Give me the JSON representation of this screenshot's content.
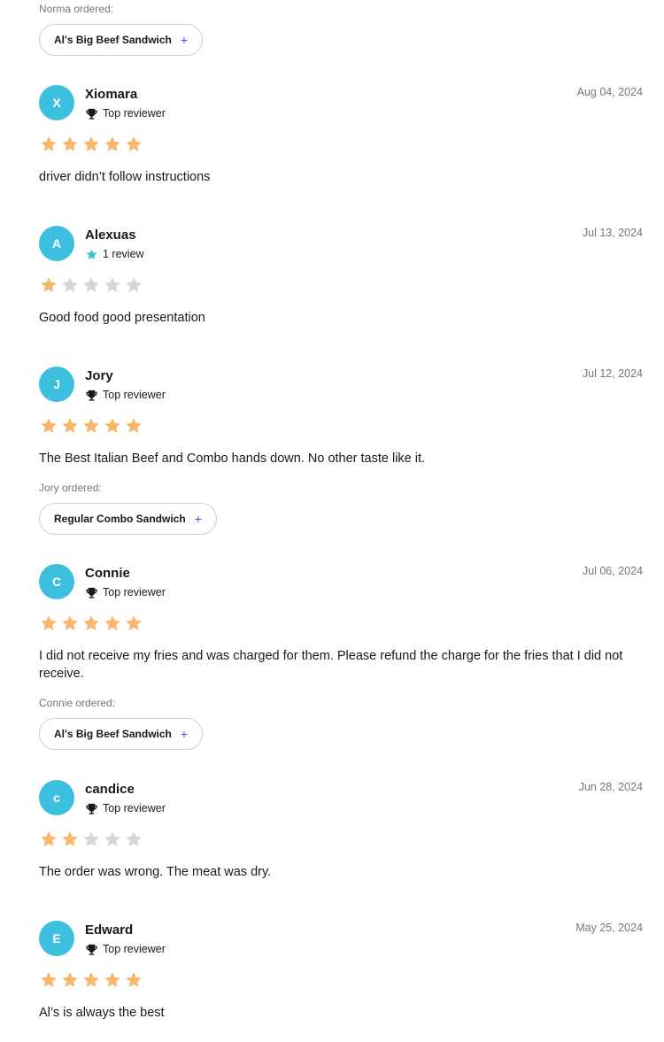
{
  "colors": {
    "avatar_bg": "#3dbfe0",
    "star_filled": "#f8b76b",
    "star_empty": "#d6d6d6",
    "plus_accent": "#5a3ed6",
    "muted_text": "#767676"
  },
  "top_order": {
    "ordered_label": "Norma ordered:",
    "item": "Al's Big Beef Sandwich",
    "plus_icon": "plus-icon"
  },
  "reviews": [
    {
      "initial": "X",
      "name": "Xiomara",
      "badge": "Top reviewer",
      "badge_icon": "trophy-icon",
      "date": "Aug 04, 2024",
      "rating": 5,
      "text": "driver didn’t follow instructions"
    },
    {
      "initial": "A",
      "name": "Alexuas",
      "badge": "1 review",
      "badge_icon": "star-icon",
      "date": "Jul 13, 2024",
      "rating": 1,
      "text": "Good food good presentation"
    },
    {
      "initial": "J",
      "name": "Jory",
      "badge": "Top reviewer",
      "badge_icon": "trophy-icon",
      "date": "Jul 12, 2024",
      "rating": 5,
      "text": "The Best Italian Beef and Combo hands down. No other taste like it.",
      "ordered_label": "Jory ordered:",
      "ordered_item": "Regular Combo Sandwich"
    },
    {
      "initial": "C",
      "name": "Connie",
      "badge": "Top reviewer",
      "badge_icon": "trophy-icon",
      "date": "Jul 06, 2024",
      "rating": 5,
      "text": "I did not receive my fries and was charged for them. Please refund the charge for the fries that I did not receive.",
      "ordered_label": "Connie ordered:",
      "ordered_item": "Al's Big Beef Sandwich"
    },
    {
      "initial": "c",
      "name": "candice",
      "badge": "Top reviewer",
      "badge_icon": "trophy-icon",
      "date": "Jun 28, 2024",
      "rating": 2,
      "text": "The order was wrong. The meat was dry."
    },
    {
      "initial": "E",
      "name": "Edward",
      "badge": "Top reviewer",
      "badge_icon": "trophy-icon",
      "date": "May 25, 2024",
      "rating": 5,
      "text": "Al’s is always the best"
    }
  ]
}
